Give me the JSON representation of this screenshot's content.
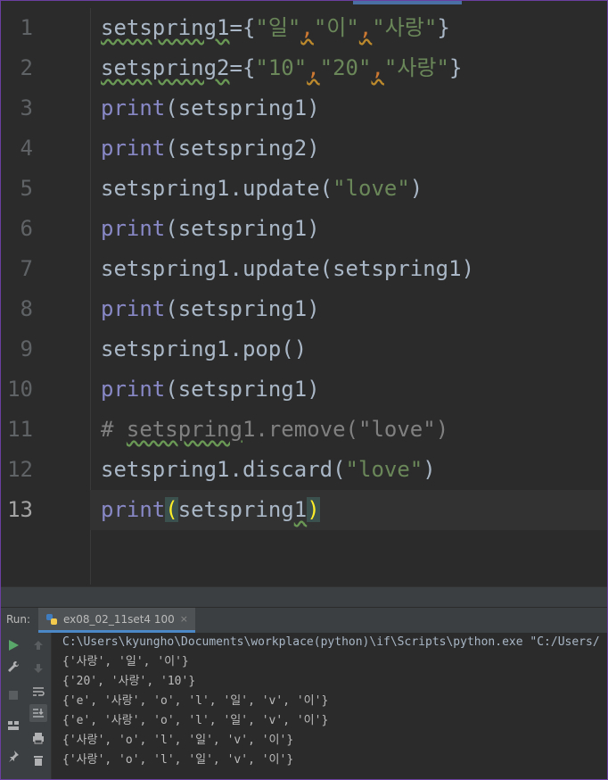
{
  "editor": {
    "line_numbers": [
      "1",
      "2",
      "3",
      "4",
      "5",
      "6",
      "7",
      "8",
      "9",
      "10",
      "11",
      "12",
      "13"
    ],
    "current_line": 13,
    "lines": [
      [
        {
          "t": "setspring1",
          "c": "var warn"
        },
        {
          "t": "={",
          "c": "var"
        },
        {
          "t": "\"일\"",
          "c": "str"
        },
        {
          "t": ",",
          "c": "comma-warn"
        },
        {
          "t": "\"이\"",
          "c": "str"
        },
        {
          "t": ",",
          "c": "comma-warn"
        },
        {
          "t": "\"사랑\"",
          "c": "str"
        },
        {
          "t": "}",
          "c": "var"
        }
      ],
      [
        {
          "t": "setspring2",
          "c": "var warn"
        },
        {
          "t": "={",
          "c": "var"
        },
        {
          "t": "\"10\"",
          "c": "str"
        },
        {
          "t": ",",
          "c": "comma-warn"
        },
        {
          "t": "\"20\"",
          "c": "str"
        },
        {
          "t": ",",
          "c": "comma-warn"
        },
        {
          "t": "\"사랑\"",
          "c": "str"
        },
        {
          "t": "}",
          "c": "var"
        }
      ],
      [
        {
          "t": "print",
          "c": "kw"
        },
        {
          "t": "(setspring1)",
          "c": "var"
        }
      ],
      [
        {
          "t": "print",
          "c": "kw"
        },
        {
          "t": "(setspring2)",
          "c": "var"
        }
      ],
      [
        {
          "t": "setspring1.update(",
          "c": "var"
        },
        {
          "t": "\"love\"",
          "c": "str"
        },
        {
          "t": ")",
          "c": "var"
        }
      ],
      [
        {
          "t": "print",
          "c": "kw"
        },
        {
          "t": "(setspring1)",
          "c": "var"
        }
      ],
      [
        {
          "t": "setspring1.update(setspring1)",
          "c": "var"
        }
      ],
      [
        {
          "t": "print",
          "c": "kw"
        },
        {
          "t": "(setspring1)",
          "c": "var"
        }
      ],
      [
        {
          "t": "setspring1.pop()",
          "c": "var"
        }
      ],
      [
        {
          "t": "print",
          "c": "kw"
        },
        {
          "t": "(setspring1)",
          "c": "var"
        }
      ],
      [
        {
          "t": "# ",
          "c": "comment"
        },
        {
          "t": "setspring",
          "c": "comment warn"
        },
        {
          "t": "1.remove(\"love\")",
          "c": "comment"
        }
      ],
      [
        {
          "t": "setspring1.discard(",
          "c": "var"
        },
        {
          "t": "\"love\"",
          "c": "str"
        },
        {
          "t": ")",
          "c": "var"
        }
      ],
      [
        {
          "t": "print",
          "c": "kw"
        },
        {
          "t": "(",
          "c": "brace-hl"
        },
        {
          "t": "setspring",
          "c": "var"
        },
        {
          "t": "1",
          "c": "var warn"
        },
        {
          "t": ")",
          "c": "brace-hl"
        }
      ]
    ]
  },
  "run_panel": {
    "label": "Run:",
    "tab_name": "ex08_02_11set4 100",
    "close_symbol": "×",
    "console_lines": [
      "C:\\Users\\kyungho\\Documents\\workplace(python)\\if\\Scripts\\python.exe \"C:/Users/",
      "{'사랑', '일', '이'}",
      "{'20', '사랑', '10'}",
      "{'e', '사랑', 'o', 'l', '일', 'v', '이'}",
      "{'e', '사랑', 'o', 'l', '일', 'v', '이'}",
      "{'사랑', 'o', 'l', '일', 'v', '이'}",
      "{'사랑', 'o', 'l', '일', 'v', '이'}"
    ]
  },
  "icons": {
    "left_toolbar": [
      "run-icon",
      "wrench-icon",
      "stop-icon",
      "layout-icon",
      "pin-icon"
    ],
    "second_toolbar": [
      "up-arrow-icon",
      "down-arrow-icon",
      "soft-wrap-icon",
      "scroll-to-end-icon",
      "print-icon",
      "trash-icon"
    ]
  },
  "colors": {
    "background": "#2b2b2b",
    "keyword": "#8888c6",
    "string": "#6a8759",
    "identifier": "#a9b7c6",
    "comment": "#808080",
    "accent": "#4a88c7",
    "run_green": "#59a869"
  }
}
